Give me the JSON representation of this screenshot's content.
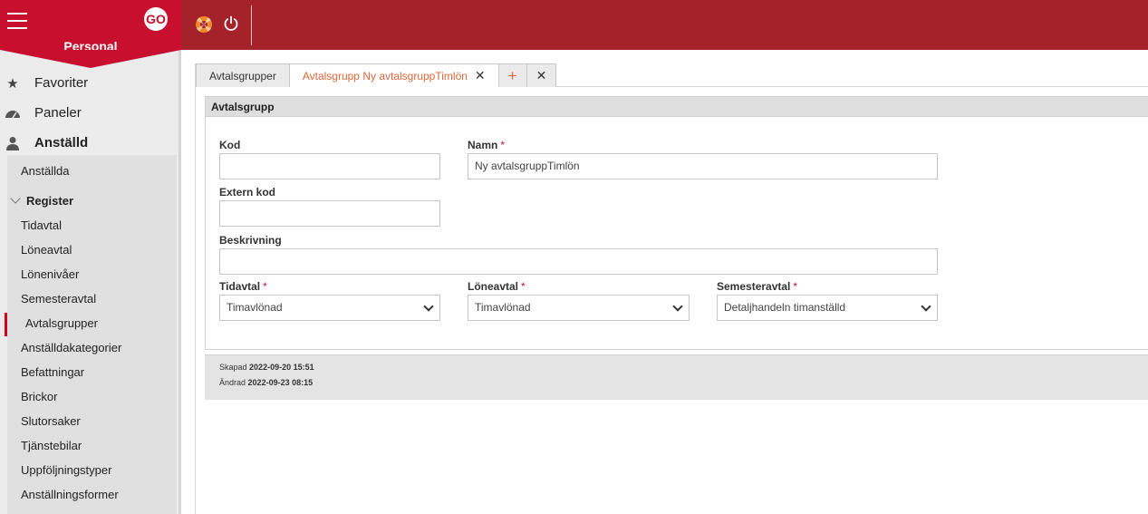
{
  "app": {
    "section_title": "Personal",
    "colors": {
      "brand": "#c8102e",
      "topbar": "#a6222a",
      "accent": "#e0673c"
    }
  },
  "topbar": {
    "help_icon": "lifebuoy-icon",
    "power_icon": "power-icon"
  },
  "sidebar": {
    "main": [
      {
        "label": "Favoriter",
        "icon": "star-icon"
      },
      {
        "label": "Paneler",
        "icon": "dashboard-icon"
      },
      {
        "label": "Anställd",
        "icon": "person-icon"
      }
    ],
    "sub_top": "Anställda",
    "register_label": "Register",
    "register_items": [
      "Tidavtal",
      "Löneavtal",
      "Lönenivåer",
      "Semesteravtal",
      "Avtalsgrupper",
      "Anställdakategorier",
      "Befattningar",
      "Brickor",
      "Slutorsaker",
      "Tjänstebilar",
      "Uppföljningstyper",
      "Anställningsformer"
    ],
    "active_item": "Avtalsgrupper"
  },
  "tabs": [
    {
      "label": "Avtalsgrupper"
    },
    {
      "label": "Avtalsgrupp Ny avtalsgruppTimlön",
      "close": "✕"
    }
  ],
  "tab_actions": {
    "add": "+",
    "close": "✕"
  },
  "form": {
    "title": "Avtalsgrupp",
    "kod": {
      "label": "Kod",
      "value": ""
    },
    "namn": {
      "label": "Namn",
      "value": "Ny avtalsgruppTimlön",
      "required": "*"
    },
    "extern_kod": {
      "label": "Extern kod",
      "value": ""
    },
    "beskrivning": {
      "label": "Beskrivning",
      "value": ""
    },
    "tidavtal": {
      "label": "Tidavtal",
      "value": "Timavlönad",
      "required": "*"
    },
    "loneavtal": {
      "label": "Löneavtal",
      "value": "Timavlönad",
      "required": "*"
    },
    "semesteravtal": {
      "label": "Semesteravtal",
      "value": "Detaljhandeln timanställd",
      "required": "*"
    }
  },
  "meta": {
    "created_label": "Skapad",
    "created_value": "2022-09-20 15:51",
    "changed_label": "Ändrad",
    "changed_value": "2022-09-23 08:15"
  }
}
